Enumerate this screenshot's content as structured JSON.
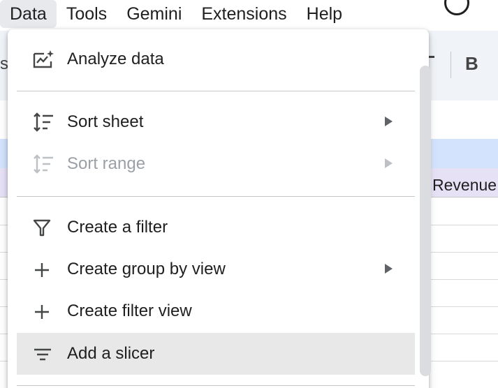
{
  "menubar": {
    "items": [
      {
        "label": "Data",
        "active": true
      },
      {
        "label": "Tools",
        "active": false
      },
      {
        "label": "Gemini",
        "active": false
      },
      {
        "label": "Extensions",
        "active": false
      },
      {
        "label": "Help",
        "active": false
      }
    ]
  },
  "toolbar": {
    "bold_label": "B",
    "left_fragment": "s"
  },
  "sheet": {
    "visible_cell": "Revenue"
  },
  "dropdown": {
    "items": [
      {
        "label": "Analyze data",
        "icon": "analyze-data-icon",
        "submenu": false,
        "disabled": false
      },
      {
        "label": "Sort sheet",
        "icon": "sort-icon",
        "submenu": true,
        "disabled": false
      },
      {
        "label": "Sort range",
        "icon": "sort-icon",
        "submenu": true,
        "disabled": true
      },
      {
        "label": "Create a filter",
        "icon": "filter-icon",
        "submenu": false,
        "disabled": false
      },
      {
        "label": "Create group by view",
        "icon": "plus-icon",
        "submenu": true,
        "disabled": false
      },
      {
        "label": "Create filter view",
        "icon": "plus-icon",
        "submenu": false,
        "disabled": false
      },
      {
        "label": "Add a slicer",
        "icon": "slicer-icon",
        "submenu": false,
        "disabled": false,
        "highlighted": true
      }
    ]
  },
  "colors": {
    "menu_active_bg": "#e7e9ed",
    "header_blue": "#d3e3fd",
    "row_purple": "#e6e1f5",
    "disabled_text": "#9aa0a6",
    "highlight_bg": "#e8e8e8"
  }
}
